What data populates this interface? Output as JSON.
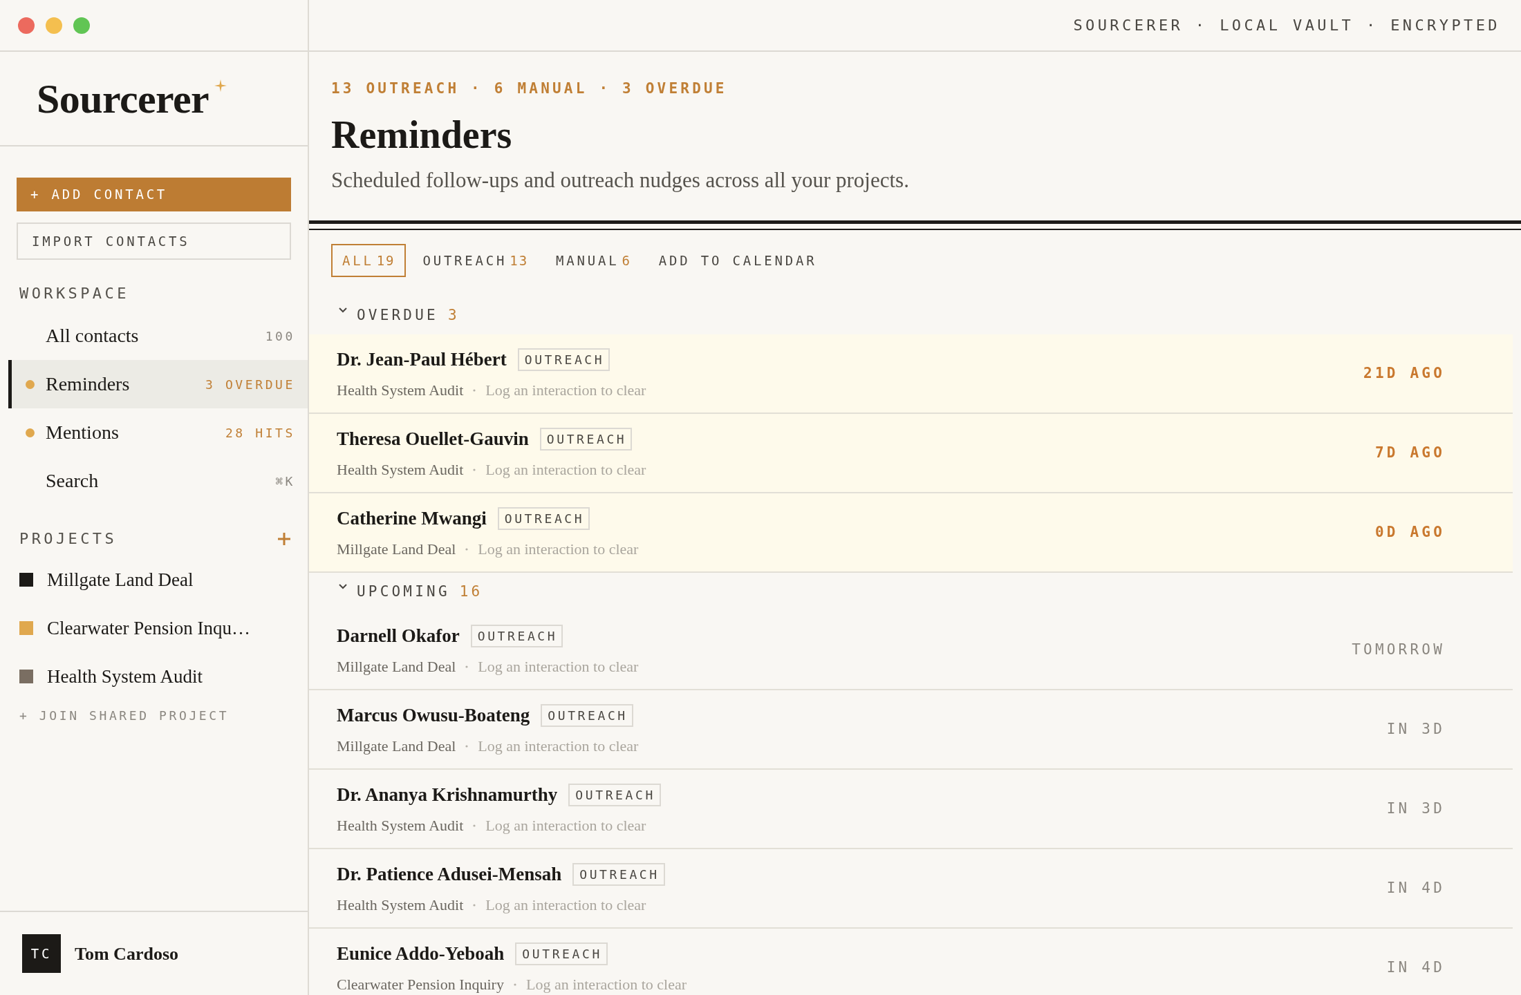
{
  "title_bar": {
    "status": "SOURCERER · LOCAL VAULT · ENCRYPTED"
  },
  "sidebar": {
    "logo": "Sourcerer",
    "buttons": [
      {
        "label": "+ ADD CONTACT",
        "kind": "primary"
      },
      {
        "label": "IMPORT CONTACTS",
        "kind": "outline"
      }
    ],
    "workspace": {
      "heading": "WORKSPACE",
      "items": [
        {
          "label": "All contacts",
          "count": "100",
          "selected": false,
          "flagged": false
        },
        {
          "label": "Reminders",
          "count": "3 OVERDUE",
          "selected": true,
          "flagged": true
        },
        {
          "label": "Mentions",
          "count": "28 HITS",
          "selected": false,
          "flagged": true
        },
        {
          "label": "Search",
          "count": "⌘K",
          "selected": false,
          "flagged": false
        }
      ]
    },
    "projects": {
      "heading": "PROJECTS",
      "items": [
        {
          "label": "Millgate Land Deal",
          "color": "#1c1a17"
        },
        {
          "label": "Clearwater Pension Inqu…",
          "color": "#e0a84e"
        },
        {
          "label": "Health System Audit",
          "color": "#7a6e62"
        }
      ],
      "join_link": "+ JOIN SHARED PROJECT"
    },
    "user": {
      "initials": "TC",
      "name": "Tom Cardoso"
    }
  },
  "main": {
    "eyebrow": "13 OUTREACH · 6 MANUAL · 3 OVERDUE",
    "title": "Reminders",
    "subtitle": "Scheduled follow-ups and outreach nudges across all your projects.",
    "tabs": [
      {
        "label": "ALL",
        "count": "19",
        "selected": true
      },
      {
        "label": "OUTREACH",
        "count": "13",
        "selected": false
      },
      {
        "label": "MANUAL",
        "count": "6",
        "selected": false
      },
      {
        "label": "ADD TO CALENDAR",
        "selected": false
      }
    ],
    "groups": [
      {
        "title": "OVERDUE",
        "count": "3",
        "expanded": true,
        "overdue": true,
        "reminders": [
          {
            "name": "Dr. Jean-Paul Hébert",
            "tag": "OUTREACH",
            "project": "Health System Audit",
            "hint": "Log an interaction to clear",
            "due": "21D AGO"
          },
          {
            "name": "Theresa Ouellet-Gauvin",
            "tag": "OUTREACH",
            "project": "Health System Audit",
            "hint": "Log an interaction to clear",
            "due": "7D AGO"
          },
          {
            "name": "Catherine Mwangi",
            "tag": "OUTREACH",
            "project": "Millgate Land Deal",
            "hint": "Log an interaction to clear",
            "due": "0D AGO"
          }
        ]
      },
      {
        "title": "UPCOMING",
        "count": "16",
        "expanded": true,
        "overdue": false,
        "reminders": [
          {
            "name": "Darnell Okafor",
            "tag": "OUTREACH",
            "project": "Millgate Land Deal",
            "hint": "Log an interaction to clear",
            "due": "TOMORROW"
          },
          {
            "name": "Marcus Owusu-Boateng",
            "tag": "OUTREACH",
            "project": "Millgate Land Deal",
            "hint": "Log an interaction to clear",
            "due": "IN 3D"
          },
          {
            "name": "Dr. Ananya Krishnamurthy",
            "tag": "OUTREACH",
            "project": "Health System Audit",
            "hint": "Log an interaction to clear",
            "due": "IN 3D"
          },
          {
            "name": "Dr. Patience Adusei-Mensah",
            "tag": "OUTREACH",
            "project": "Health System Audit",
            "hint": "Log an interaction to clear",
            "due": "IN 4D"
          },
          {
            "name": "Eunice Addo-Yeboah",
            "tag": "OUTREACH",
            "project": "Clearwater Pension Inquiry",
            "hint": "Log an interaction to clear",
            "due": "IN 4D"
          }
        ]
      }
    ]
  }
}
